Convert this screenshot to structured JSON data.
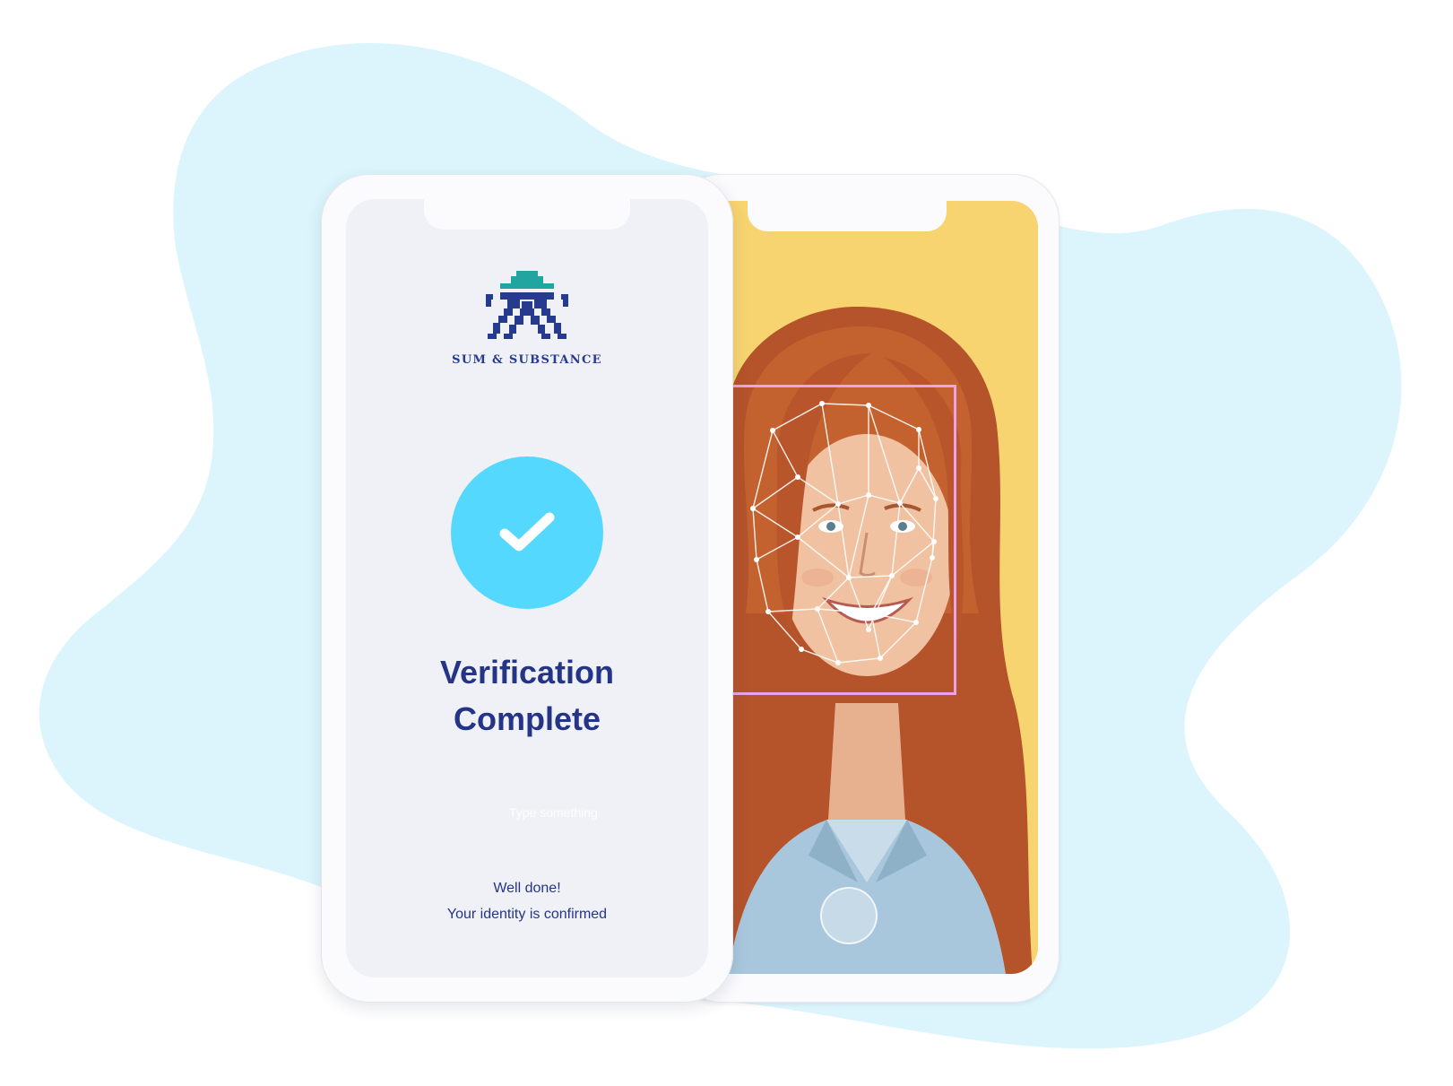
{
  "brand": {
    "name": "SUM & SUBSTANCE",
    "logo_icon": "pixel-figure-with-hat-logo",
    "colors": {
      "hat": "#21a5a0",
      "body": "#263a8e"
    }
  },
  "verification": {
    "status_icon": "checkmark-icon",
    "title_line1": "Verification",
    "title_line2": "Complete",
    "input_placeholder": "Type something",
    "message_line1": "Well done!",
    "message_line2": "Your identity is confirmed",
    "accent_color": "#55d8fe",
    "text_color": "#243587"
  },
  "camera": {
    "background_color": "#f7d470",
    "face_box_color": "#e9a3e8",
    "overlay": "face-landmark-mesh",
    "shutter_icon": "shutter-button-icon"
  }
}
